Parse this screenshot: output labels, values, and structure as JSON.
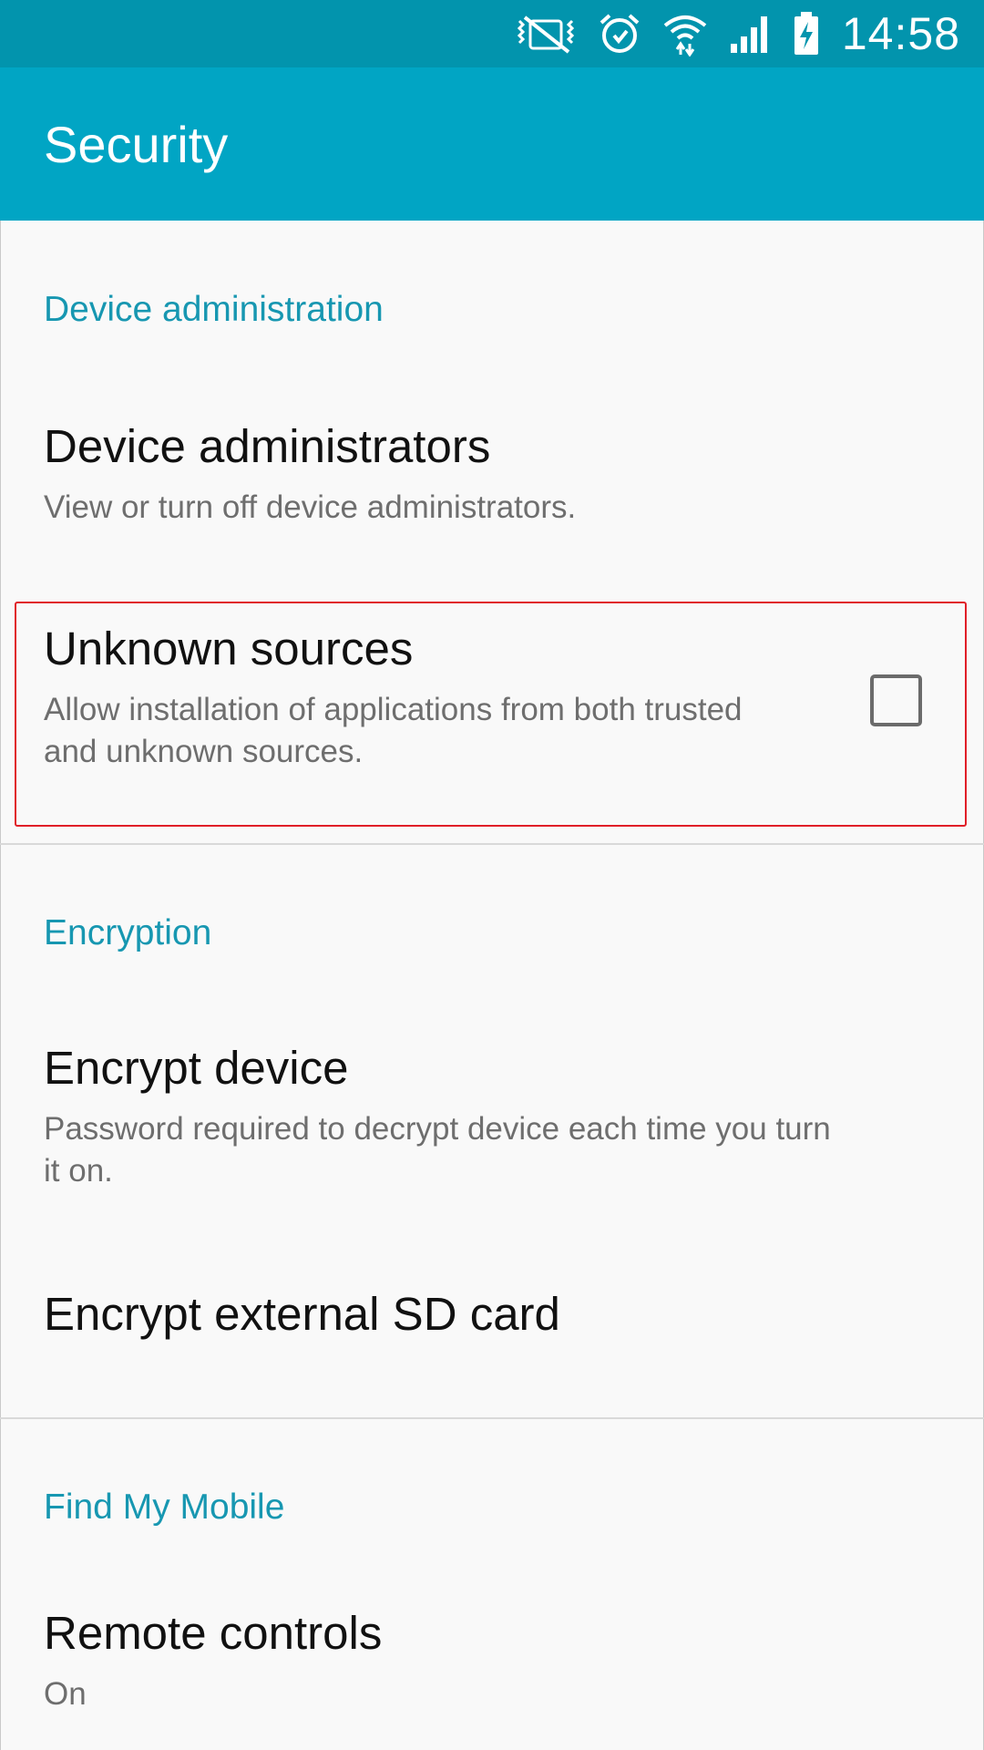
{
  "status_bar": {
    "icons": [
      "vibrate-mute-icon",
      "alarm-icon",
      "wifi-icon",
      "signal-icon",
      "battery-charging-icon"
    ],
    "time": "14:58"
  },
  "app_bar": {
    "title": "Security"
  },
  "sections": {
    "device_admin": {
      "header": "Device administration",
      "items": {
        "device_administrators": {
          "title": "Device administrators",
          "summary": "View or turn off device administrators."
        },
        "unknown_sources": {
          "title": "Unknown sources",
          "summary_line1": "Allow installation of applications from both trusted",
          "summary_line2": "and unknown sources.",
          "checked": false
        }
      }
    },
    "encryption": {
      "header": "Encryption",
      "items": {
        "encrypt_device": {
          "title": "Encrypt device",
          "summary_line1": "Password required to decrypt device each time you turn",
          "summary_line2": "it on."
        },
        "encrypt_sd": {
          "title": "Encrypt external SD card"
        }
      }
    },
    "find_my_mobile": {
      "header": "Find My Mobile",
      "items": {
        "remote_controls": {
          "title": "Remote controls",
          "summary": "On"
        }
      }
    }
  },
  "colors": {
    "status_bar": "#0294ad",
    "app_bar": "#01a5c4",
    "section_header": "#1797b1",
    "highlight_border": "#e01f28"
  }
}
